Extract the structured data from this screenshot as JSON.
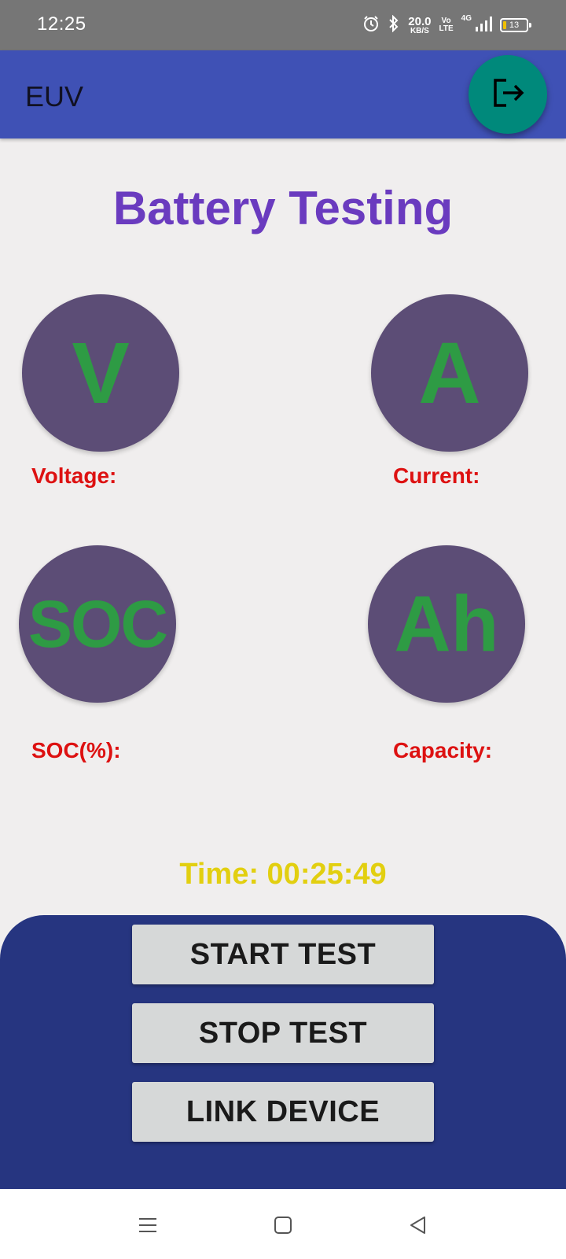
{
  "status_bar": {
    "time": "12:25",
    "net_speed_value": "20.0",
    "net_speed_unit": "KB/S",
    "volte_top": "Vo",
    "volte_bottom": "LTE",
    "network": "4G",
    "battery_level": "13",
    "icons": [
      "alarm-icon",
      "bluetooth-icon",
      "signal-icon",
      "battery-icon"
    ]
  },
  "app_bar": {
    "title": "EUV",
    "logout_icon": "logout-icon"
  },
  "page_title": "Battery Testing",
  "gauges": {
    "voltage": {
      "symbol": "V",
      "label": "Voltage:"
    },
    "current": {
      "symbol": "A",
      "label": "Current:"
    },
    "soc": {
      "symbol": "SOC",
      "label": "SOC(%):"
    },
    "capacity": {
      "symbol": "Ah",
      "label": "Capacity:"
    }
  },
  "timer": "Time: 00:25:49",
  "buttons": {
    "start": "START TEST",
    "stop": "STOP TEST",
    "link": "LINK DEVICE"
  },
  "nav_bar": {
    "icons": [
      "menu-icon",
      "home-icon",
      "back-icon"
    ]
  },
  "colors": {
    "app_bar": "#3f51b5",
    "fab": "#00897b",
    "title": "#6a3bbf",
    "gauge_bg": "#5c4d76",
    "gauge_text": "#2e9b44",
    "label": "#dd1111",
    "timer": "#e2cf10",
    "panel": "#263580"
  }
}
